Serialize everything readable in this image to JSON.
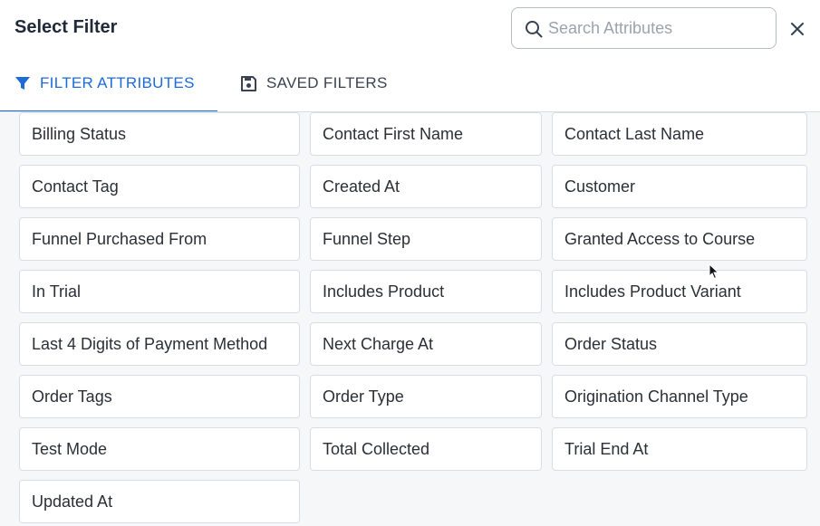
{
  "header": {
    "title": "Select Filter",
    "search_placeholder": "Search Attributes"
  },
  "tabs": [
    {
      "label": "FILTER ATTRIBUTES",
      "icon": "funnel-icon",
      "active": true
    },
    {
      "label": "SAVED FILTERS",
      "icon": "save-icon",
      "active": false
    }
  ],
  "colors": {
    "accent": "#1d6bd6"
  },
  "attributes": [
    "Billing Status",
    "Contact First Name",
    "Contact Last Name",
    "Contact Tag",
    "Created At",
    "Customer",
    "Funnel Purchased From",
    "Funnel Step",
    "Granted Access to Course",
    "In Trial",
    "Includes Product",
    "Includes Product Variant",
    "Last 4 Digits of Payment Method",
    "Next Charge At",
    "Order Status",
    "Order Tags",
    "Order Type",
    "Origination Channel Type",
    "Test Mode",
    "Total Collected",
    "Trial End At",
    "Updated At"
  ]
}
